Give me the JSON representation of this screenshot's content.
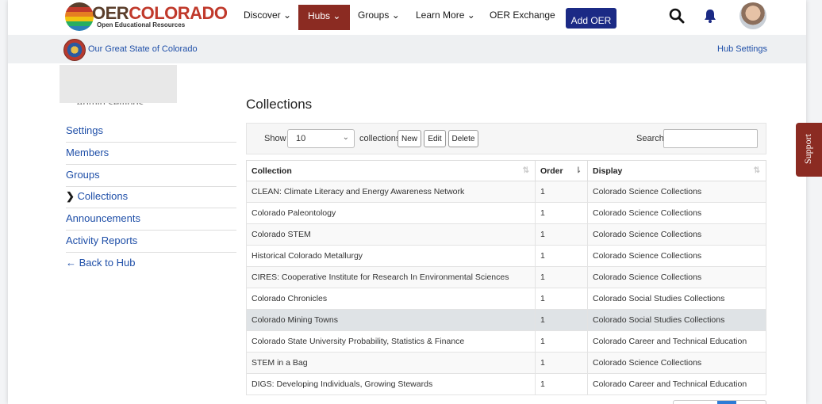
{
  "brand": {
    "title_a": "OER",
    "title_b": "COLORADO",
    "subtitle": "Open Educational Resources",
    "stripe_colors": [
      "#5a3e2b",
      "#c0392b",
      "#e67e22",
      "#f1c40f",
      "#27ae60",
      "#2c7fb8"
    ]
  },
  "nav": {
    "discover": "Discover",
    "hubs": "Hubs",
    "groups": "Groups",
    "learn_more": "Learn More",
    "oer_exchange": "OER Exchange",
    "add_oer": "Add OER",
    "chevron": "⌄"
  },
  "hub": {
    "name": "Our Great State of Colorado",
    "settings": "Hub Settings"
  },
  "sidebar": {
    "heading": "Admin settings",
    "items": [
      {
        "label": "Settings",
        "prefix": ""
      },
      {
        "label": "Members",
        "prefix": ""
      },
      {
        "label": "Groups",
        "prefix": ""
      },
      {
        "label": "Collections",
        "prefix": "❯ "
      },
      {
        "label": "Announcements",
        "prefix": ""
      },
      {
        "label": "Activity Reports",
        "prefix": ""
      },
      {
        "label": "Back to Hub",
        "prefix": "← "
      }
    ]
  },
  "main": {
    "title": "Collections",
    "show_label": "Show",
    "page_size": "10",
    "collections_label": "collections",
    "new_label": "New",
    "edit_label": "Edit",
    "delete_label": "Delete",
    "search_label": "Search:",
    "search_value": ""
  },
  "table": {
    "headers": [
      "Collection",
      "Order",
      "Display"
    ],
    "rows": [
      [
        "CLEAN: Climate Literacy and Energy Awareness Network",
        "1",
        "Colorado Science Collections"
      ],
      [
        "Colorado Paleontology",
        "1",
        "Colorado Science Collections"
      ],
      [
        "Colorado STEM",
        "1",
        "Colorado Science Collections"
      ],
      [
        "Historical Colorado Metallurgy",
        "1",
        "Colorado Science Collections"
      ],
      [
        "CIRES: Cooperative Institute for Research In Environmental Sciences",
        "1",
        "Colorado Science Collections"
      ],
      [
        "Colorado Chronicles",
        "1",
        "Colorado Social Studies Collections"
      ],
      [
        "Colorado Mining Towns",
        "1",
        "Colorado Social Studies Collections"
      ],
      [
        "Colorado State University Probability, Statistics & Finance",
        "1",
        "Colorado Career and Technical Education"
      ],
      [
        "STEM in a Bag",
        "1",
        "Colorado Science Collections"
      ],
      [
        "DIGS: Developing Individuals, Growing Stewards",
        "1",
        "Colorado Career and Technical Education"
      ]
    ],
    "highlighted_row": 6
  },
  "support": {
    "label": "Support"
  }
}
